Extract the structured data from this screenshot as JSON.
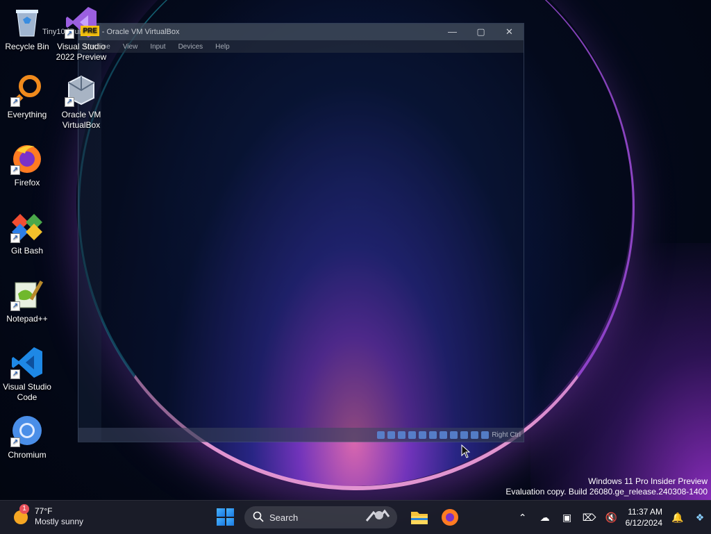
{
  "desktop": {
    "icons": [
      {
        "id": "recycle-bin",
        "label": "Recycle Bin"
      },
      {
        "id": "visual-studio-2022-preview",
        "label": "Visual Studio 2022 Preview",
        "badge": "PRE"
      },
      {
        "id": "everything",
        "label": "Everything"
      },
      {
        "id": "oracle-vm-virtualbox",
        "label": "Oracle VM VirtualBox"
      },
      {
        "id": "firefox",
        "label": "Firefox"
      },
      {
        "id": "git-bash",
        "label": "Git Bash"
      },
      {
        "id": "notepad-plus-plus",
        "label": "Notepad++"
      },
      {
        "id": "visual-studio-code",
        "label": "Visual Studio Code"
      },
      {
        "id": "chromium",
        "label": "Chromium"
      }
    ]
  },
  "vm_window": {
    "title": "Tiny10 [Running] - Oracle VM VirtualBox",
    "menu": [
      "Machine",
      "View",
      "Input",
      "Devices",
      "Help"
    ],
    "host_key": "Right Ctrl"
  },
  "watermark": {
    "line1": "Windows 11 Pro Insider Preview",
    "line2": "Evaluation copy. Build 26080.ge_release.240308-1400"
  },
  "taskbar": {
    "weather_temp": "77°F",
    "weather_desc": "Mostly sunny",
    "weather_badge": "1",
    "search_placeholder": "Search",
    "clock_time": "11:37 AM",
    "clock_date": "6/12/2024"
  },
  "colors": {
    "accent": "#1a78e0",
    "taskbar_bg": "#1c1e2a",
    "pre_badge": "#f5c211"
  }
}
